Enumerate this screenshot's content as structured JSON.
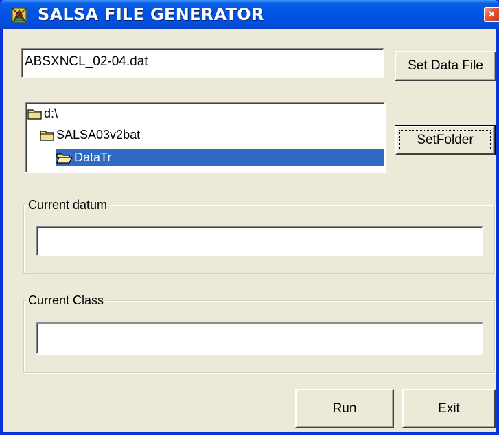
{
  "window": {
    "title": "SALSA FILE GENERATOR",
    "close_glyph": "×"
  },
  "data_file": {
    "value": "ABSXNCL_02-04.dat",
    "button_label": "Set Data File"
  },
  "folder_tree": {
    "items": [
      {
        "label": "d:\\",
        "icon": "folder-icon",
        "selected": false
      },
      {
        "label": "SALSA03v2bat",
        "icon": "folder-icon",
        "selected": false
      },
      {
        "label": "DataTr",
        "icon": "open-folder-icon",
        "selected": true
      }
    ],
    "button_label": "SetFolder"
  },
  "current_datum": {
    "label": "Current datum",
    "value": ""
  },
  "current_class": {
    "label": "Current Class",
    "value": ""
  },
  "actions": {
    "run_label": "Run",
    "exit_label": "Exit"
  },
  "colors": {
    "titlebar": "#0054e3",
    "face": "#ece9d8",
    "selection": "#316ac5",
    "close": "#e0553a"
  }
}
